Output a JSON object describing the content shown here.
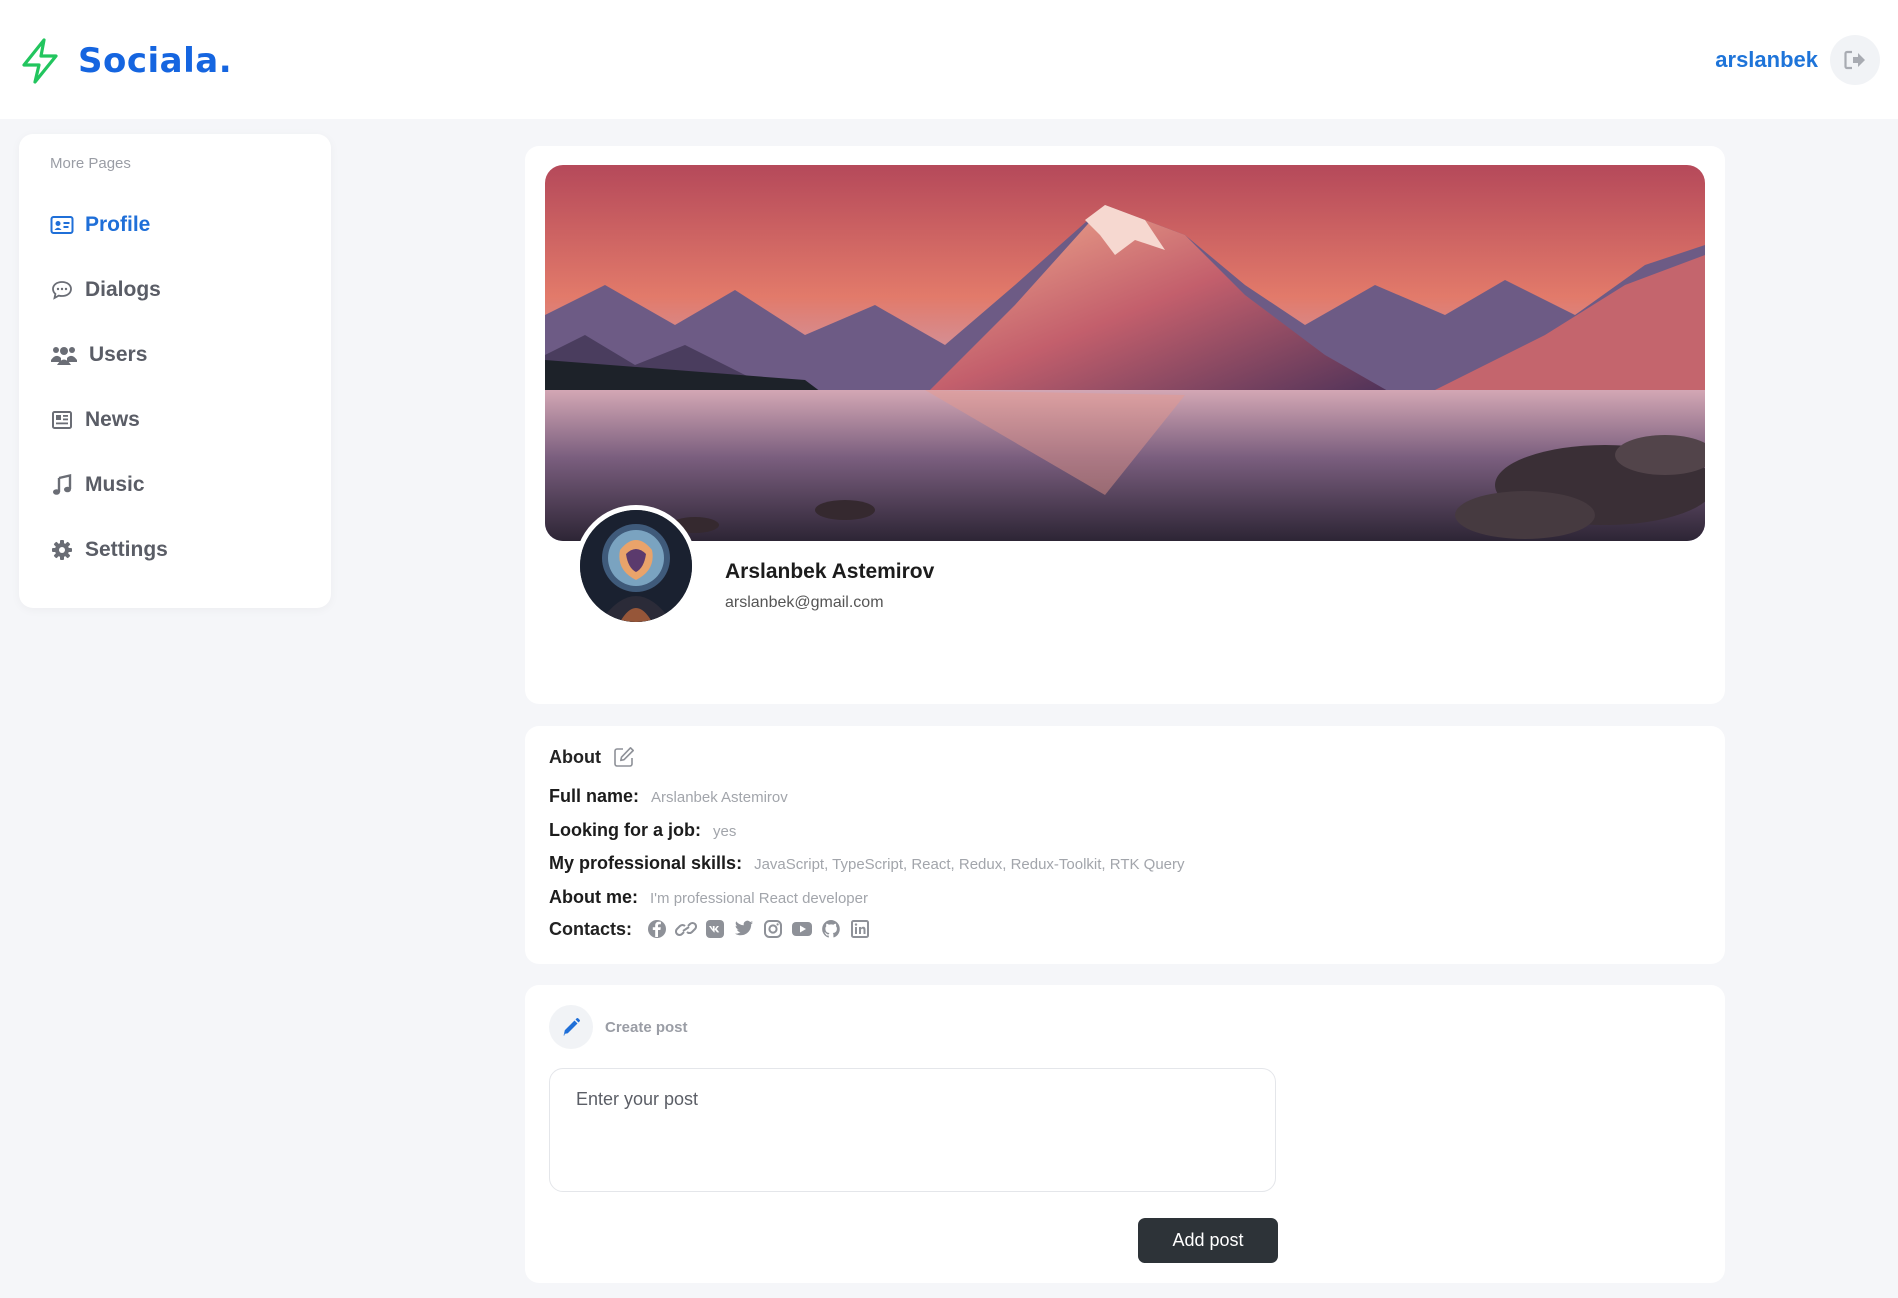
{
  "app": {
    "logo_text": "Sociala.",
    "brand_color": "#1565e0",
    "logo_accent": "#22c55e"
  },
  "header": {
    "username": "arslanbek",
    "logout_icon": "logout-icon"
  },
  "sidebar": {
    "caption": "More Pages",
    "items": [
      {
        "label": "Profile",
        "icon": "id-card-icon",
        "active": true
      },
      {
        "label": "Dialogs",
        "icon": "chat-bubble-icon",
        "active": false
      },
      {
        "label": "Users",
        "icon": "users-icon",
        "active": false
      },
      {
        "label": "News",
        "icon": "newspaper-icon",
        "active": false
      },
      {
        "label": "Music",
        "icon": "music-note-icon",
        "active": false
      },
      {
        "label": "Settings",
        "icon": "gear-icon",
        "active": false
      }
    ]
  },
  "profile": {
    "name": "Arslanbek Astemirov",
    "email": "arslanbek@gmail.com"
  },
  "about": {
    "title": "About",
    "rows": [
      {
        "label": "Full name:",
        "value": "Arslanbek Astemirov"
      },
      {
        "label": "Looking for a job:",
        "value": "yes"
      },
      {
        "label": "My professional skills:",
        "value": "JavaScript, TypeScript, React, Redux, Redux-Toolkit, RTK Query"
      },
      {
        "label": "About me:",
        "value": "I'm professional React developer"
      }
    ],
    "contacts_label": "Contacts:",
    "contacts": [
      "facebook-icon",
      "website-link-icon",
      "vk-icon",
      "twitter-icon",
      "instagram-icon",
      "youtube-icon",
      "github-icon",
      "linkedin-icon"
    ]
  },
  "post": {
    "title": "Create post",
    "placeholder": "Enter your post",
    "button": "Add post"
  }
}
